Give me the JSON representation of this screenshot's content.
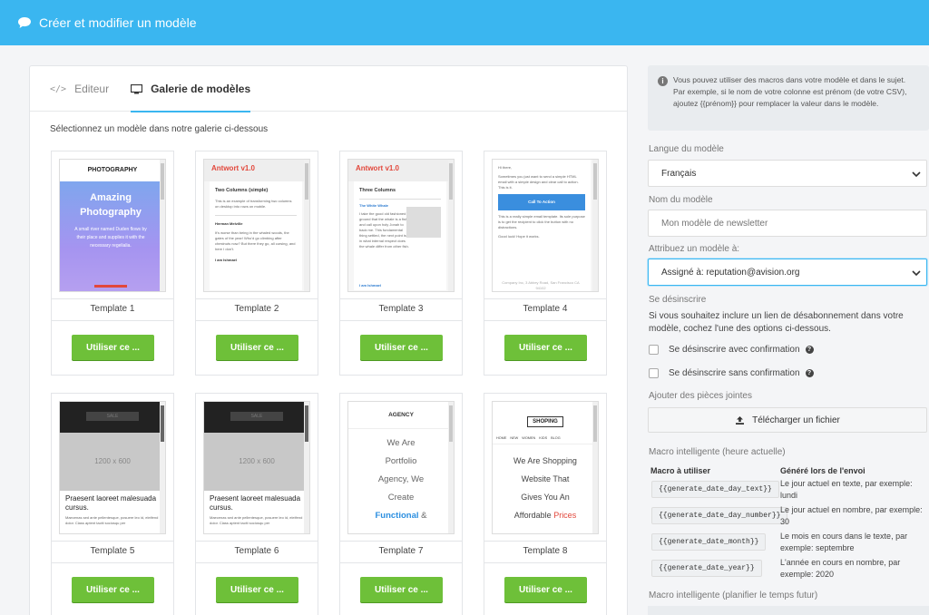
{
  "topbar": {
    "title": "Créer et modifier un modèle"
  },
  "tabs": [
    {
      "label": "Editeur"
    },
    {
      "label": "Galerie de modèles"
    }
  ],
  "gallery": {
    "intro": "Sélectionnez un modèle dans notre galerie ci-dessous",
    "button_label": "Utiliser ce ...",
    "templates": [
      {
        "name": "Template 1",
        "header": "PHOTOGRAPHY",
        "hero_line1": "Amazing",
        "hero_line2": "Photography",
        "body": "A small river named Duden flows by their place and supplies it with the necessary regelialia."
      },
      {
        "name": "Template 2",
        "brand": "Antwort v1.0",
        "heading": "Two Columns (simple)",
        "intro": "This is an example of transforming two columns on desktop into rows on mobile.",
        "sub": "Herman Melville",
        "body": "It's worse than being in the whaled woods, the gates of the year! Who'd go climbing after chestnuts now? But there they go, all cursing, and here I don't.",
        "footer": "I am Ishmael"
      },
      {
        "name": "Template 3",
        "brand": "Antwort v1.0",
        "heading": "Three Columns",
        "sub": "The White Whale",
        "body": "I take the good old fashioned ground that the whale is a fish, and call upon holy Jonah to back me. This fundamental thing settled, the next point is, in what internal respect does the whale differ from other fish.",
        "footer": "I am Ishmael"
      },
      {
        "name": "Template 4",
        "greeting": "Hi there,",
        "body": "Sometimes you just want to send a simple HTML email with a simple design and clear call to action. This is it.",
        "cta": "Call To Action",
        "body2": "This is a really simple email template. Its sole purpose is to get the recipient to click the button with no distractions.",
        "signoff": "Good luck! Hope it works.",
        "footer": "Company Inc, 3 Abbey Road, San Francisco CA 94102"
      },
      {
        "name": "Template 5",
        "logo": "SALE",
        "placeholder": "1200 x 600",
        "title": "Praesent laoreet malesuada cursus.",
        "body": "Maecenas sed ante pellentesque, posuere leo id, eleifend dolor. Class aptent taciti sociosqu per"
      },
      {
        "name": "Template 6",
        "logo": "SALE",
        "placeholder": "1200 x 600",
        "title": "Praesent laoreet malesuada cursus.",
        "body": "Maecenas sed ante pellentesque, posuere leo id, eleifend dolor. Class aptent taciti sociosqu per"
      },
      {
        "name": "Template 7",
        "header": "AGENCY",
        "line1": "We Are",
        "line2": "Portfolio",
        "line3": "Agency, We",
        "line4": "Create",
        "highlight": "Functional",
        "amp": "&"
      },
      {
        "name": "Template 8",
        "header": "SHOPING",
        "nav": [
          "HOME",
          "NEW",
          "WOMEN",
          "KIDS",
          "BLOG"
        ],
        "line1": "We Are Shopping",
        "line2": "Website That",
        "line3": "Gives You An",
        "line4": "Affordable",
        "highlight": "Prices"
      }
    ]
  },
  "sidebar": {
    "info_line1": "Vous pouvez utiliser des macros dans votre modèle et dans le sujet.",
    "info_line2": "Par exemple, si le nom de votre colonne est prénom (de votre CSV), ajoutez {{prénom}} pour remplacer la valeur dans le modèle.",
    "language_label": "Langue du modèle",
    "language_value": "Français",
    "name_label": "Nom du modèle",
    "name_placeholder": "Mon modèle de newsletter",
    "assign_label": "Attribuez un modèle à:",
    "assign_value": "Assigné à: reputation@avision.org",
    "unsubscribe_label": "Se désinscrire",
    "unsubscribe_text": "Si vous souhaitez inclure un lien de désabonnement dans votre modèle, cochez l'une des options ci-dessous.",
    "option1": "Se désinscrire avec confirmation",
    "option2": "Se désinscrire sans confirmation",
    "attachments_label": "Ajouter des pièces jointes",
    "upload_label": "Télécharger un fichier",
    "macro_now_label": "Macro intelligente (heure actuelle)",
    "macro_col1": "Macro à utiliser",
    "macro_col2": "Généré lors de l'envoi",
    "macros": [
      {
        "tag": "{{generate_date_day_text}}",
        "desc_line1": "Le jour actuel en texte, par exemple:",
        "desc_line2": "lundi"
      },
      {
        "tag": "{{generate_date_day_number}}",
        "desc_line1": "Le jour actuel en nombre, par exemple:",
        "desc_line2": "30"
      },
      {
        "tag": "{{generate_date_month}}",
        "desc_line1": "Le mois en cours dans le texte, par",
        "desc_line2": "exemple: septembre"
      },
      {
        "tag": "{{generate_date_year}}",
        "desc_line1": "L'année en cours en nombre, par",
        "desc_line2": "exemple: 2020"
      }
    ],
    "macro_future_label": "Macro intelligente (planifier le temps futur)"
  },
  "colors": {
    "topbar": "#3ab6f0",
    "button": "#6ec039",
    "accent": "#3ab6f0",
    "brand_red": "#e2473b"
  }
}
